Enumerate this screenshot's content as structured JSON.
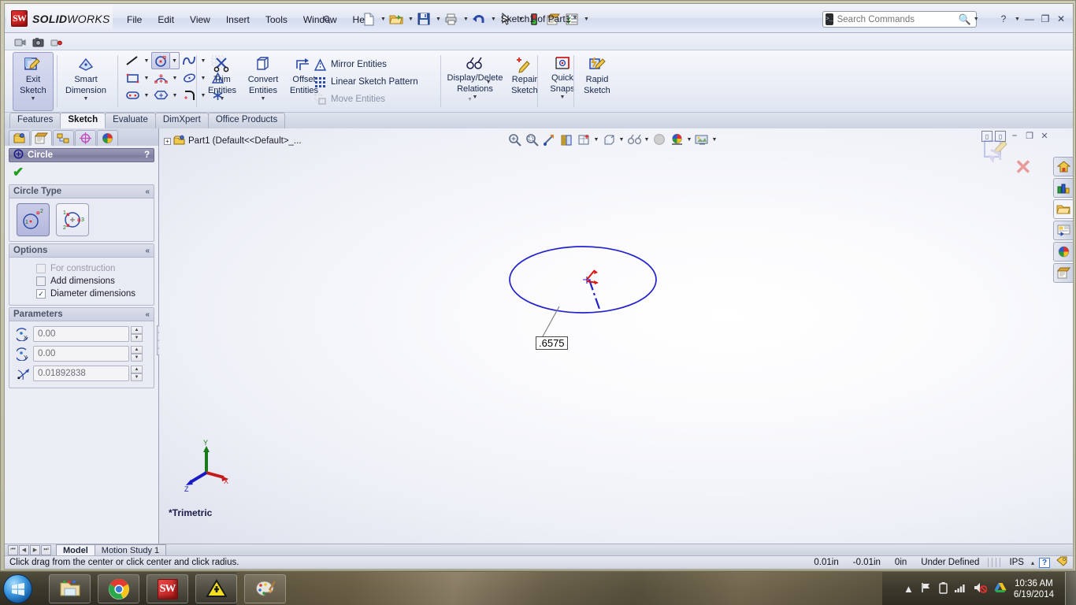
{
  "app": {
    "brand_bold": "SOLID",
    "brand_light": "WORKS",
    "cube_text": "SW",
    "document_title": "Sketch1 of Part1 *"
  },
  "menu": {
    "items": [
      "File",
      "Edit",
      "View",
      "Insert",
      "Tools",
      "Window",
      "Help"
    ]
  },
  "quick_access": {
    "buttons": [
      {
        "name": "new-document",
        "icon": "📄"
      },
      {
        "name": "open-document",
        "icon": "📂"
      },
      {
        "name": "save",
        "icon": "💾"
      },
      {
        "name": "print",
        "icon": "🖨"
      },
      {
        "name": "undo",
        "icon": "↶"
      },
      {
        "name": "select",
        "icon": "➤"
      },
      {
        "name": "rebuild",
        "icon": "🚦"
      },
      {
        "name": "options",
        "icon": "📝"
      },
      {
        "name": "customize",
        "icon": "📋"
      }
    ]
  },
  "search": {
    "placeholder": "Search Commands",
    "value": ""
  },
  "window_controls": {
    "help": "?",
    "minimize": "—",
    "restore": "❐",
    "close": "✕"
  },
  "ribbon": {
    "groups": {
      "exit_sketch": {
        "label_line1": "Exit",
        "label_line2": "Sketch"
      },
      "smart_dimension": {
        "label_line1": "Smart",
        "label_line2": "Dimension"
      },
      "trim_entities": {
        "label_line1": "Trim",
        "label_line2": "Entities"
      },
      "convert_entities": {
        "label_line1": "Convert",
        "label_line2": "Entities"
      },
      "offset_entities": {
        "label_line1": "Offset",
        "label_line2": "Entities"
      },
      "display_delete_relations": {
        "label_line1": "Display/Delete",
        "label_line2": "Relations"
      },
      "repair_sketch": {
        "label_line1": "Repair",
        "label_line2": "Sketch"
      },
      "quick_snaps": {
        "label_line1": "Quick",
        "label_line2": "Snaps"
      },
      "rapid_sketch": {
        "label_line1": "Rapid",
        "label_line2": "Sketch"
      }
    },
    "text_commands": [
      {
        "name": "mirror-entities",
        "label": "Mirror Entities",
        "enabled": true
      },
      {
        "name": "linear-sketch-pattern",
        "label": "Linear Sketch Pattern",
        "enabled": true
      },
      {
        "name": "move-entities",
        "label": "Move Entities",
        "enabled": false
      }
    ],
    "entity_tools": [
      {
        "name": "line-tool",
        "active": false
      },
      {
        "name": "circle-tool",
        "active": true
      },
      {
        "name": "spline-tool",
        "active": false
      },
      {
        "name": "grid-snap-tool",
        "active": false
      },
      {
        "name": "rectangle-tool",
        "active": false
      },
      {
        "name": "arc-tool",
        "active": false
      },
      {
        "name": "ellipse-tool",
        "active": false
      },
      {
        "name": "sketch-text-tool",
        "active": false
      },
      {
        "name": "slot-tool",
        "active": false
      },
      {
        "name": "polygon-tool",
        "active": false
      },
      {
        "name": "fillet-tool",
        "active": false
      },
      {
        "name": "point-tool",
        "active": false
      }
    ]
  },
  "command_tabs": [
    {
      "label": "Features",
      "active": false
    },
    {
      "label": "Sketch",
      "active": true
    },
    {
      "label": "Evaluate",
      "active": false
    },
    {
      "label": "DimXpert",
      "active": false
    },
    {
      "label": "Office Products",
      "active": false
    }
  ],
  "property_manager": {
    "tabs": [
      {
        "name": "feature-manager-tab",
        "icon": "📐",
        "active": false
      },
      {
        "name": "property-manager-tab",
        "icon": "📝",
        "active": true
      },
      {
        "name": "configuration-manager-tab",
        "icon": "🗂",
        "active": false
      },
      {
        "name": "dimxpert-manager-tab",
        "icon": "⊕",
        "active": false
      },
      {
        "name": "display-manager-tab",
        "icon": "●",
        "active": false
      }
    ],
    "title": "Circle",
    "help_glyph": "?",
    "ok_glyph": "✔",
    "sections": {
      "circle_type": {
        "title": "Circle Type",
        "collapse_glyph": "«",
        "options": [
          {
            "name": "center-circle",
            "selected": true
          },
          {
            "name": "perimeter-circle",
            "selected": false
          }
        ]
      },
      "options": {
        "title": "Options",
        "collapse_glyph": "«",
        "checkboxes": [
          {
            "name": "for-construction",
            "label": "For construction",
            "checked": false,
            "enabled": false
          },
          {
            "name": "add-dimensions",
            "label": "Add dimensions",
            "checked": false,
            "enabled": true
          },
          {
            "name": "diameter-dimensions",
            "label": "Diameter dimensions",
            "checked": true,
            "enabled": true
          }
        ]
      },
      "parameters": {
        "title": "Parameters",
        "collapse_glyph": "«",
        "fields": [
          {
            "name": "center-x-coordinate",
            "icon_label": "X",
            "value": "0.00"
          },
          {
            "name": "center-y-coordinate",
            "icon_label": "Y",
            "value": "0.00"
          },
          {
            "name": "radius",
            "icon_label": "R",
            "value": "0.01892838"
          }
        ]
      }
    }
  },
  "view_toolbar": {
    "buttons": [
      {
        "name": "zoom-to-fit-icon",
        "glyph": "🔍"
      },
      {
        "name": "zoom-to-area-icon",
        "glyph": "🔎"
      },
      {
        "name": "previous-view-icon",
        "glyph": "↶"
      },
      {
        "name": "section-view-icon",
        "glyph": "📕"
      },
      {
        "name": "view-orientation-icon",
        "glyph": "▦"
      },
      {
        "name": "display-style-icon",
        "glyph": "⬜"
      },
      {
        "name": "hide-show-items-icon",
        "glyph": "👓"
      },
      {
        "name": "edit-appearance-icon",
        "glyph": "●"
      },
      {
        "name": "apply-scene-icon",
        "glyph": "◕"
      },
      {
        "name": "view-settings-icon",
        "glyph": "🖼"
      }
    ]
  },
  "document_controls": [
    {
      "name": "restore-left-icon",
      "glyph": "▣"
    },
    {
      "name": "restore-right-icon",
      "glyph": "▣"
    },
    {
      "name": "minimize-doc-icon",
      "glyph": "—"
    },
    {
      "name": "restore-doc-icon",
      "glyph": "❐"
    },
    {
      "name": "close-doc-icon",
      "glyph": "✕"
    }
  ],
  "feature_tree": {
    "expander": "+",
    "root_label": "Part1  (Default<<Default>_..."
  },
  "task_pane": {
    "tabs": [
      {
        "name": "solidworks-resources-tab",
        "icon": "🏠",
        "active": false
      },
      {
        "name": "design-library-tab",
        "icon": "📊",
        "active": false
      },
      {
        "name": "file-explorer-tab",
        "icon": "📁",
        "active": true
      },
      {
        "name": "view-palette-tab",
        "icon": "🗒",
        "active": false
      },
      {
        "name": "appearances-scenes-tab",
        "icon": "🎨",
        "active": false
      },
      {
        "name": "custom-properties-tab",
        "icon": "📋",
        "active": false
      }
    ]
  },
  "graphics_area": {
    "view_orientation_label": "*Trimetric",
    "dimension_label": ".6575",
    "triad_axes": {
      "x": "X",
      "y": "Y",
      "z": "Z"
    },
    "confirm_corner": {
      "exit_sketch_name": "exit-sketch-confirm-icon",
      "cancel_name": "cancel-sketch-icon",
      "cancel_glyph": "✕"
    }
  },
  "bottom_tabs": {
    "nav_buttons": [
      "⏮",
      "◀",
      "▶",
      "⏭"
    ],
    "tabs": [
      {
        "label": "Model",
        "active": true
      },
      {
        "label": "Motion Study 1",
        "active": false
      }
    ]
  },
  "status_bar": {
    "message": "Click drag from the center or click center and click radius.",
    "x_coordinate": "0.01in",
    "y_coordinate": "-0.01in",
    "z_coordinate": "0in",
    "sketch_state": "Under Defined",
    "units": "IPS",
    "units_caret": "▴",
    "help_glyph": "?",
    "tag_name": "tags-icon"
  },
  "taskbar": {
    "start_name": "start-button",
    "items": [
      {
        "name": "taskbar-windows-explorer",
        "icon": "📁"
      },
      {
        "name": "taskbar-google-chrome",
        "icon": "chrome"
      },
      {
        "name": "taskbar-solidworks",
        "icon": "SW"
      },
      {
        "name": "taskbar-warning-app",
        "icon": "⚠"
      },
      {
        "name": "taskbar-paint",
        "icon": "🎨"
      }
    ],
    "tray": [
      {
        "name": "show-hidden-icons",
        "glyph": "▲"
      },
      {
        "name": "action-center-flag-icon",
        "glyph": "⚑"
      },
      {
        "name": "battery-icon",
        "glyph": "🔋"
      },
      {
        "name": "network-icon",
        "glyph": "ᵟ"
      },
      {
        "name": "volume-muted-icon",
        "glyph": "🔇"
      },
      {
        "name": "google-drive-icon",
        "glyph": "△"
      }
    ],
    "clock_time": "10:36 AM",
    "clock_date": "6/19/2014"
  },
  "colors": {
    "sketch_blue": "#2222cc",
    "origin_red": "#e01010",
    "accent_green": "#1f9e1f"
  }
}
